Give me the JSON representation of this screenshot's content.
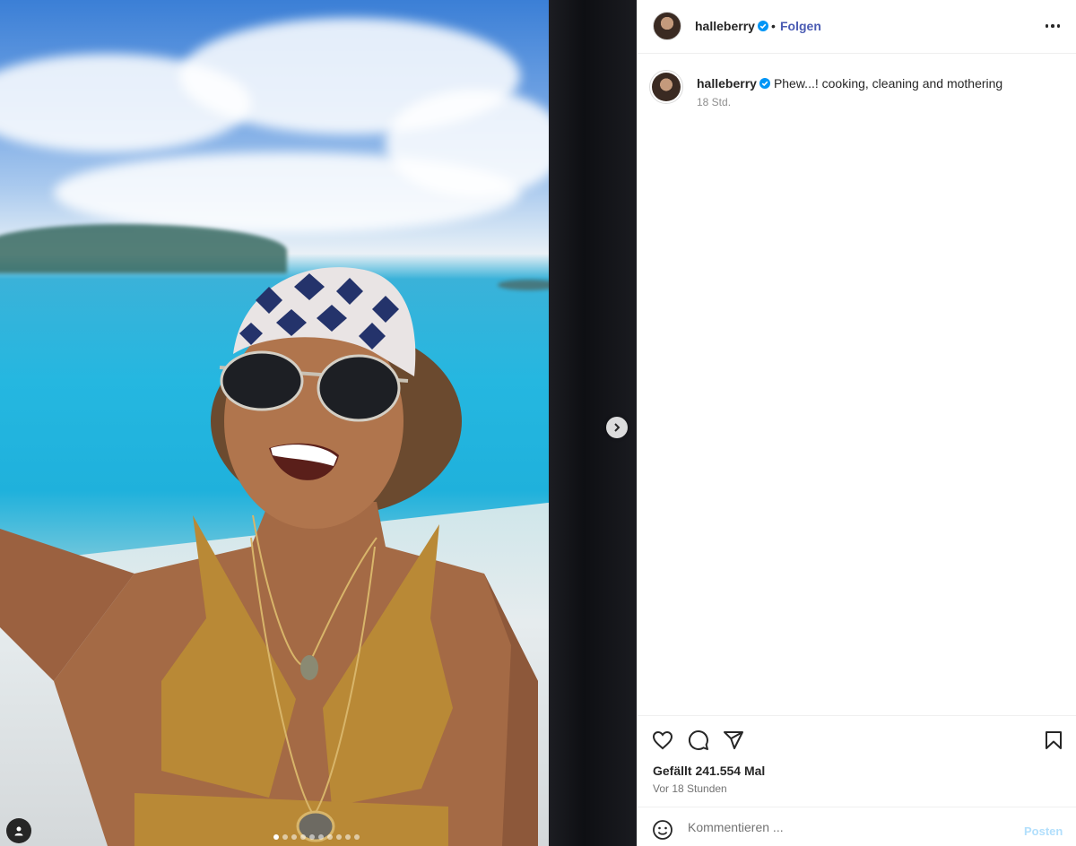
{
  "post": {
    "username": "halleberry",
    "verified": true,
    "separator": "•",
    "follow_label": "Folgen",
    "more_icon": "more-horizontal-icon",
    "media": {
      "carousel_slides": 10,
      "active_slide": 1,
      "next_icon": "chevron-right-icon",
      "tag_icon": "user-tag-icon"
    }
  },
  "caption": {
    "username": "halleberry",
    "text": "Phew...! cooking, cleaning and mothering",
    "time": "18 Std."
  },
  "actions": {
    "like_icon": "heart-icon",
    "comment_icon": "comment-icon",
    "share_icon": "send-icon",
    "save_icon": "bookmark-icon"
  },
  "stats": {
    "likes": "Gefällt 241.554 Mal",
    "posted": "Vor 18 Stunden"
  },
  "comment": {
    "emoji_icon": "emoji-icon",
    "placeholder": "Kommentieren ...",
    "post_label": "Posten"
  },
  "colors": {
    "follow": "#4a5bb3",
    "verified": "#0095f6",
    "post_disabled": "#b2dffc"
  }
}
